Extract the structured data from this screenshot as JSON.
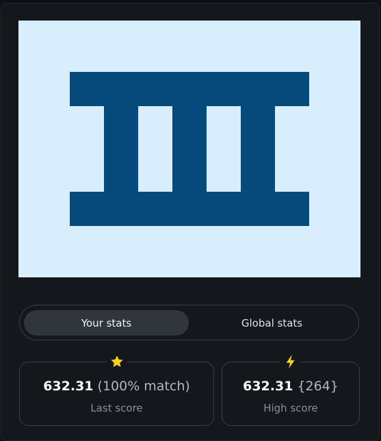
{
  "tabs": [
    {
      "label": "Your stats",
      "active": true
    },
    {
      "label": "Global stats",
      "active": false
    }
  ],
  "last_score": {
    "value": "632.31",
    "extra": "(100% match)",
    "label": "Last score",
    "icon": "star-icon"
  },
  "high_score": {
    "value": "632.31",
    "extra": "{264}",
    "label": "High score",
    "icon": "lightning-icon"
  },
  "colors": {
    "preview_bg": "#d9eefc",
    "shape": "#054a7a",
    "accent_icon": "#f7d21e"
  }
}
